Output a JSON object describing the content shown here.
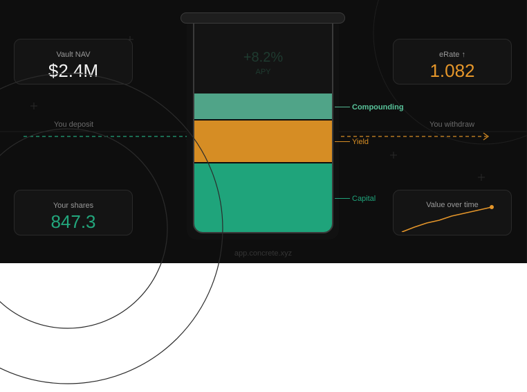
{
  "cards": {
    "vault_nav": {
      "label": "Vault NAV",
      "value": "$2.4M"
    },
    "erate": {
      "label": "eRate ↑",
      "value": "1.082"
    },
    "your_shares": {
      "label": "Your shares",
      "value": "847.3"
    },
    "value_over_time": {
      "label": "Value over time"
    }
  },
  "flows": {
    "deposit_label": "You deposit",
    "withdraw_label": "You withdraw"
  },
  "beaker": {
    "apy_value": "+8.2%",
    "apy_label": "APY",
    "layers": {
      "compounding": "Compounding",
      "yield": "Yield",
      "capital": "Capital"
    }
  },
  "footer": {
    "url": "app.concrete.xyz"
  },
  "colors": {
    "background": "#0e0e0e",
    "compounding": "#50a488",
    "yield": "#d68d24",
    "capital": "#1fa47b",
    "accent_orange": "#e5962a",
    "accent_green": "#22a67c"
  },
  "icons": {
    "deposit_arrow": "arrow-right-icon",
    "withdraw_arrow": "arrow-right-icon",
    "sparkline": "line-chart-icon"
  }
}
